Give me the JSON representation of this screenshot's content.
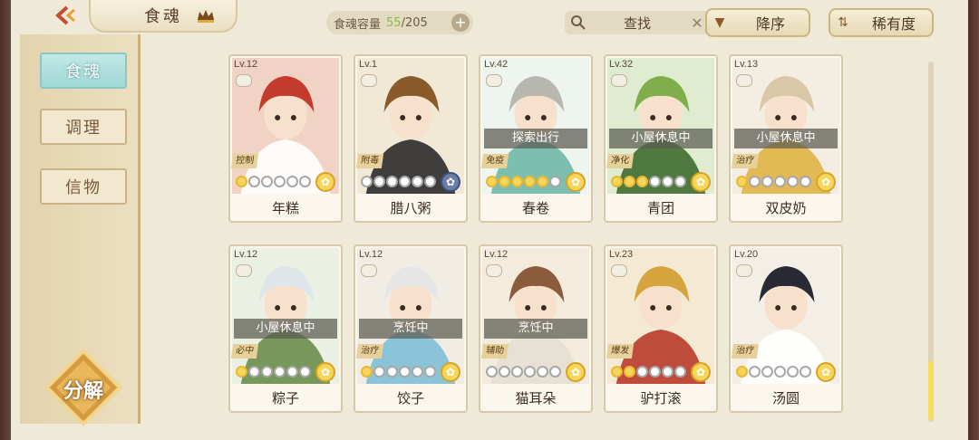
{
  "topbar": {
    "title": "食魂",
    "capacity_label": "食魂容量",
    "capacity_used": "55",
    "capacity_total": "/205",
    "search_placeholder": "查找",
    "sort_order": "降序",
    "sort_by": "稀有度"
  },
  "sidebar": {
    "tabs": [
      "食魂",
      "调理",
      "信物"
    ],
    "decompose": "分解"
  },
  "cards": [
    {
      "name": "年糕",
      "level": "Lv.12",
      "status": "",
      "role": "控制",
      "stars": 1,
      "flower": "gold",
      "palette": [
        "#f0d3c4",
        "#c43a2c",
        "#ffffff"
      ]
    },
    {
      "name": "腊八粥",
      "level": "Lv.1",
      "status": "",
      "role": "附毒",
      "stars": 0,
      "flower": "blue",
      "palette": [
        "#f1e8d6",
        "#8b5a2b",
        "#2b2b2b"
      ]
    },
    {
      "name": "春卷",
      "level": "Lv.42",
      "status": "探索出行",
      "role": "免疫",
      "stars": 5,
      "flower": "gold",
      "palette": [
        "#eef5ee",
        "#b8b8b0",
        "#6fb9a7"
      ]
    },
    {
      "name": "青团",
      "level": "Lv.32",
      "status": "小屋休息中",
      "role": "净化",
      "stars": 3,
      "flower": "gold",
      "palette": [
        "#dfecd0",
        "#7fae4a",
        "#3f6d2e"
      ]
    },
    {
      "name": "双皮奶",
      "level": "Lv.13",
      "status": "小屋休息中",
      "role": "治疗",
      "stars": 1,
      "flower": "gold",
      "palette": [
        "#f4eee2",
        "#d8c8a8",
        "#e0b344"
      ]
    },
    {
      "name": "粽子",
      "level": "Lv.12",
      "status": "小屋休息中",
      "role": "必中",
      "stars": 1,
      "flower": "gold",
      "palette": [
        "#eaf0e4",
        "#dfe6ea",
        "#6b8d4a"
      ]
    },
    {
      "name": "饺子",
      "level": "Lv.12",
      "status": "烹饪中",
      "role": "治疗",
      "stars": 1,
      "flower": "gold",
      "palette": [
        "#f1ede4",
        "#e6e6e6",
        "#7fbfd6"
      ]
    },
    {
      "name": "猫耳朵",
      "level": "Lv.12",
      "status": "烹饪中",
      "role": "辅助",
      "stars": 0,
      "flower": "gold",
      "palette": [
        "#f3ebdc",
        "#8a5c3c",
        "#e6e0d2"
      ]
    },
    {
      "name": "驴打滚",
      "level": "Lv.23",
      "status": "",
      "role": "爆发",
      "stars": 2,
      "flower": "gold",
      "palette": [
        "#f4ead4",
        "#d6a43c",
        "#b93b2a"
      ]
    },
    {
      "name": "汤圆",
      "level": "Lv.20",
      "status": "",
      "role": "治疗",
      "stars": 1,
      "flower": "gold",
      "palette": [
        "#f4efe6",
        "#2a2a35",
        "#ffffff"
      ]
    }
  ]
}
